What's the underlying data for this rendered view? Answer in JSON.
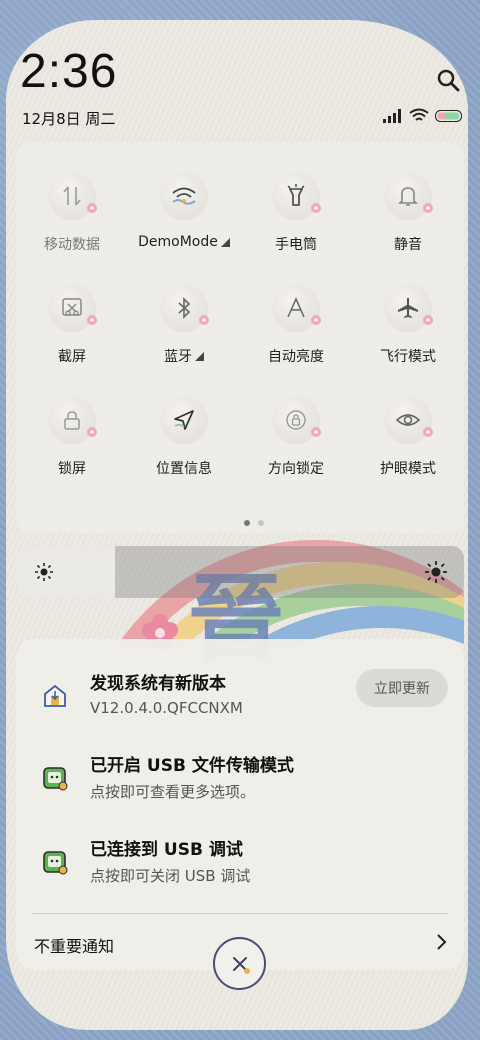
{
  "status": {
    "time": "2:36",
    "date": "12月8日 周二"
  },
  "quick_settings": {
    "tiles": [
      {
        "label": "移动数据",
        "icon": "mobile-data-icon",
        "active": false,
        "has_menu": false
      },
      {
        "label": "DemoMode",
        "icon": "wifi-icon",
        "active": true,
        "has_menu": true
      },
      {
        "label": "手电筒",
        "icon": "flashlight-icon",
        "active": false,
        "has_menu": false
      },
      {
        "label": "静音",
        "icon": "bell-icon",
        "active": false,
        "has_menu": false
      },
      {
        "label": "截屏",
        "icon": "screenshot-icon",
        "active": false,
        "has_menu": false
      },
      {
        "label": "蓝牙",
        "icon": "bluetooth-icon",
        "active": false,
        "has_menu": true
      },
      {
        "label": "自动亮度",
        "icon": "auto-brightness-icon",
        "active": false,
        "has_menu": false
      },
      {
        "label": "飞行模式",
        "icon": "airplane-icon",
        "active": false,
        "has_menu": false
      },
      {
        "label": "锁屏",
        "icon": "lock-icon",
        "active": false,
        "has_menu": false
      },
      {
        "label": "位置信息",
        "icon": "location-icon",
        "active": true,
        "has_menu": false
      },
      {
        "label": "方向锁定",
        "icon": "rotation-lock-icon",
        "active": false,
        "has_menu": false
      },
      {
        "label": "护眼模式",
        "icon": "eye-icon",
        "active": false,
        "has_menu": false
      }
    ],
    "page_count": 2,
    "current_page": 1
  },
  "brightness": {
    "level": 0.22
  },
  "notifications": {
    "items": [
      {
        "title": "发现系统有新版本",
        "subtitle": "V12.0.4.0.QFCCNXM",
        "action": "立即更新",
        "icon": "system-update-icon"
      },
      {
        "title": "已开启 USB 文件传输模式",
        "subtitle": "点按即可查看更多选项。",
        "icon": "android-debug-icon"
      },
      {
        "title": "已连接到 USB 调试",
        "subtitle": "点按即可关闭 USB 调试",
        "icon": "android-debug-icon"
      }
    ],
    "minor_label": "不重要通知"
  },
  "colors": {
    "accent_green": "#5ab54e",
    "panel_bg": "#eeece7",
    "wallpaper_blue": "#8da5c8"
  }
}
